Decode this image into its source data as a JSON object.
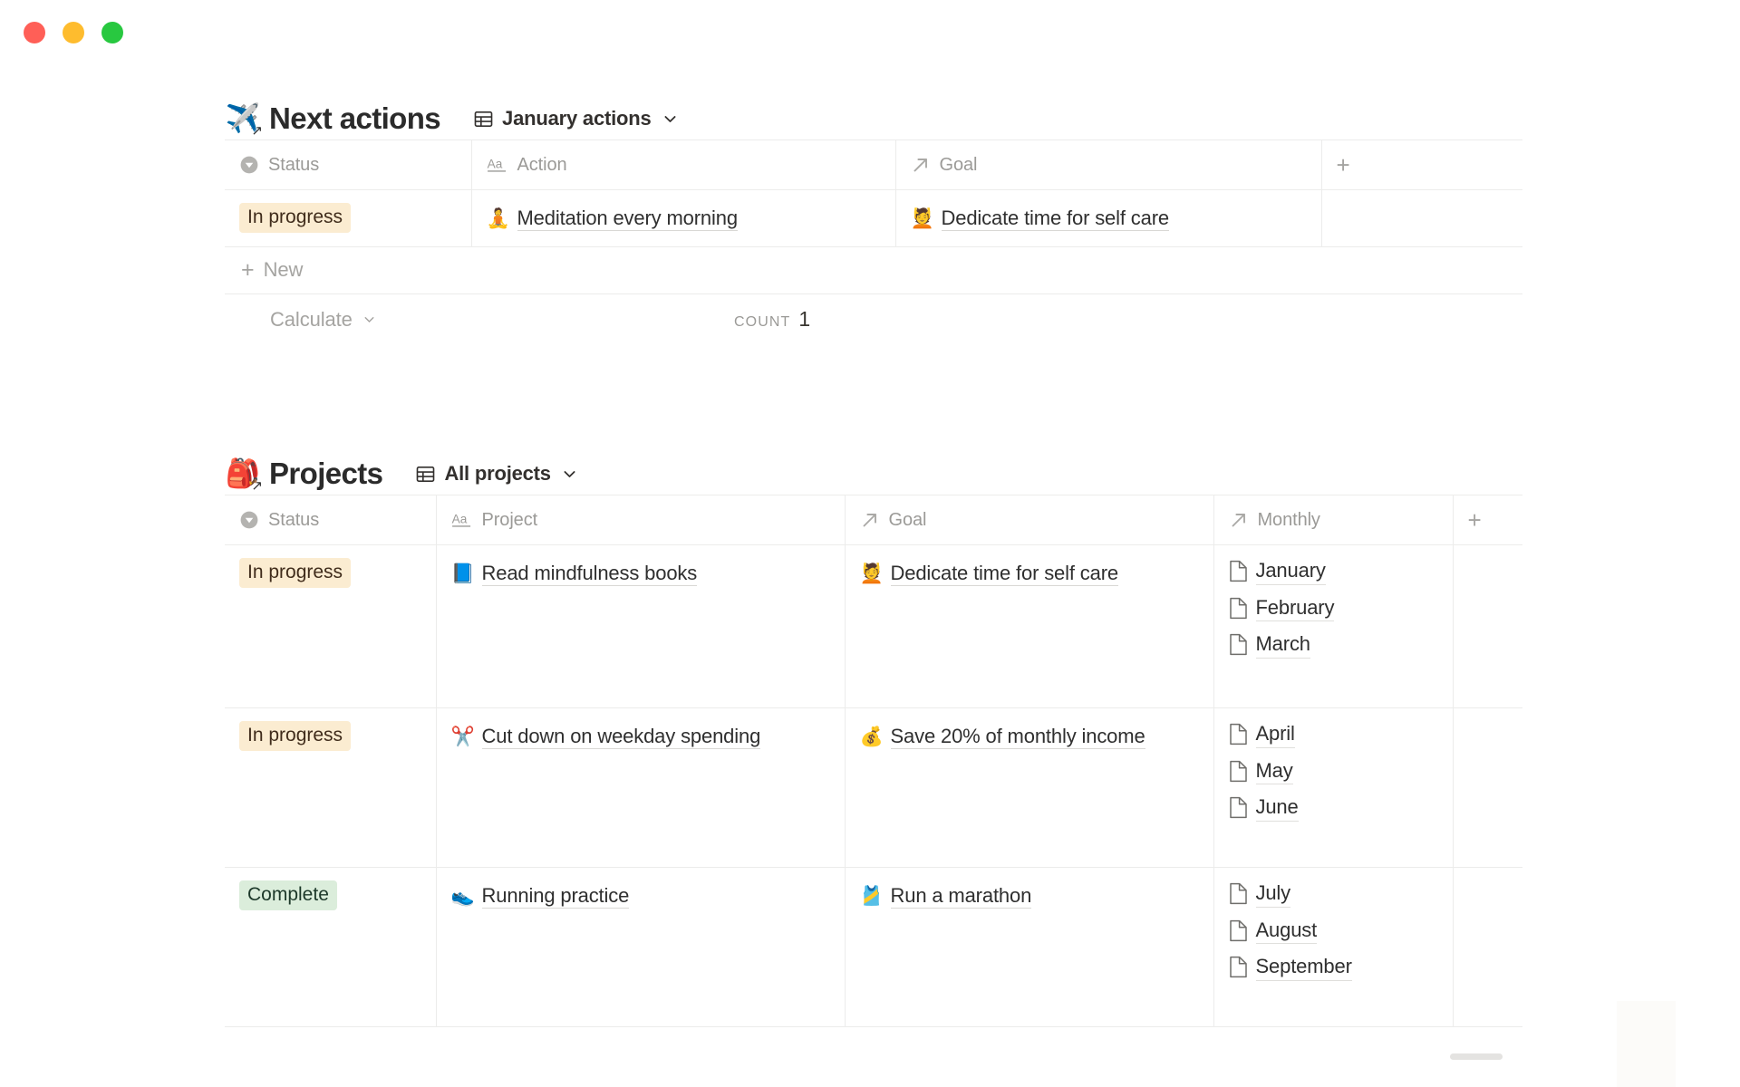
{
  "window": {
    "controls": [
      {
        "name": "close",
        "color": "#ff5f57"
      },
      {
        "name": "minimize",
        "color": "#febc2e"
      },
      {
        "name": "maximize",
        "color": "#28c840"
      }
    ]
  },
  "blocks": [
    {
      "id": "next-actions",
      "emoji": "✈️",
      "emoji_name": "airplane-emoji",
      "linked": true,
      "title": "Next actions",
      "view": {
        "name": "January actions",
        "icon": "table-icon",
        "chevron": "chevron-down-icon"
      },
      "columns": [
        {
          "key": "status",
          "label": "Status",
          "icon": "status-icon"
        },
        {
          "key": "action",
          "label": "Action",
          "icon": "title-icon"
        },
        {
          "key": "goal",
          "label": "Goal",
          "icon": "relation-icon"
        },
        {
          "key": "add",
          "label": "",
          "icon": "plus-icon"
        }
      ],
      "rows": [
        {
          "status": {
            "label": "In progress",
            "style": "inprogress"
          },
          "action": {
            "emoji": "🧘",
            "emoji_name": "person-meditating-emoji",
            "text": "Meditation every morning"
          },
          "goal": [
            {
              "emoji": "💆",
              "emoji_name": "face-massage-emoji",
              "text": "Dedicate time for self care"
            }
          ]
        }
      ],
      "new_row": {
        "label": "New",
        "icon": "plus-icon"
      },
      "footer": {
        "calculate_label": "Calculate",
        "calculate_chevron": "chevron-down-icon",
        "count_label": "COUNT",
        "count_value": "1"
      }
    },
    {
      "id": "projects",
      "emoji": "🎒",
      "emoji_name": "backpack-emoji",
      "linked": true,
      "title": "Projects",
      "view": {
        "name": "All projects",
        "icon": "table-icon",
        "chevron": "chevron-down-icon"
      },
      "columns": [
        {
          "key": "status",
          "label": "Status",
          "icon": "status-icon"
        },
        {
          "key": "project",
          "label": "Project",
          "icon": "title-icon"
        },
        {
          "key": "goal",
          "label": "Goal",
          "icon": "relation-icon"
        },
        {
          "key": "monthly",
          "label": "Monthly",
          "icon": "relation-icon"
        },
        {
          "key": "add",
          "label": "",
          "icon": "plus-icon"
        }
      ],
      "rows": [
        {
          "status": {
            "label": "In progress",
            "style": "inprogress"
          },
          "project": {
            "emoji": "📘",
            "emoji_name": "blue-book-emoji",
            "text": "Read mindfulness books"
          },
          "goal": [
            {
              "emoji": "💆",
              "emoji_name": "face-massage-emoji",
              "text": "Dedicate time for self care"
            }
          ],
          "monthly": [
            {
              "icon": "page-icon",
              "text": "January"
            },
            {
              "icon": "page-icon",
              "text": "February"
            },
            {
              "icon": "page-icon",
              "text": "March"
            }
          ]
        },
        {
          "status": {
            "label": "In progress",
            "style": "inprogress"
          },
          "project": {
            "emoji": "✂️",
            "emoji_name": "scissors-emoji",
            "text": "Cut down on weekday spending"
          },
          "goal": [
            {
              "emoji": "💰",
              "emoji_name": "money-bag-emoji",
              "text": "Save 20% of monthly income"
            }
          ],
          "monthly": [
            {
              "icon": "page-icon",
              "text": "April"
            },
            {
              "icon": "page-icon",
              "text": "May"
            },
            {
              "icon": "page-icon",
              "text": "June"
            }
          ]
        },
        {
          "status": {
            "label": "Complete",
            "style": "complete"
          },
          "project": {
            "emoji": "👟",
            "emoji_name": "running-shoe-emoji",
            "text": "Running practice"
          },
          "goal": [
            {
              "emoji": "🎽",
              "emoji_name": "running-shirt-emoji",
              "text": "Run a marathon"
            }
          ],
          "monthly": [
            {
              "icon": "page-icon",
              "text": "July"
            },
            {
              "icon": "page-icon",
              "text": "August"
            },
            {
              "icon": "page-icon",
              "text": "September"
            }
          ]
        }
      ]
    }
  ],
  "colors": {
    "status_inprogress_bg": "#fbecd1",
    "status_complete_bg": "#dbeddb",
    "text_primary": "#2f2f2f",
    "text_muted": "#9b9a97",
    "border": "#ececeb"
  }
}
